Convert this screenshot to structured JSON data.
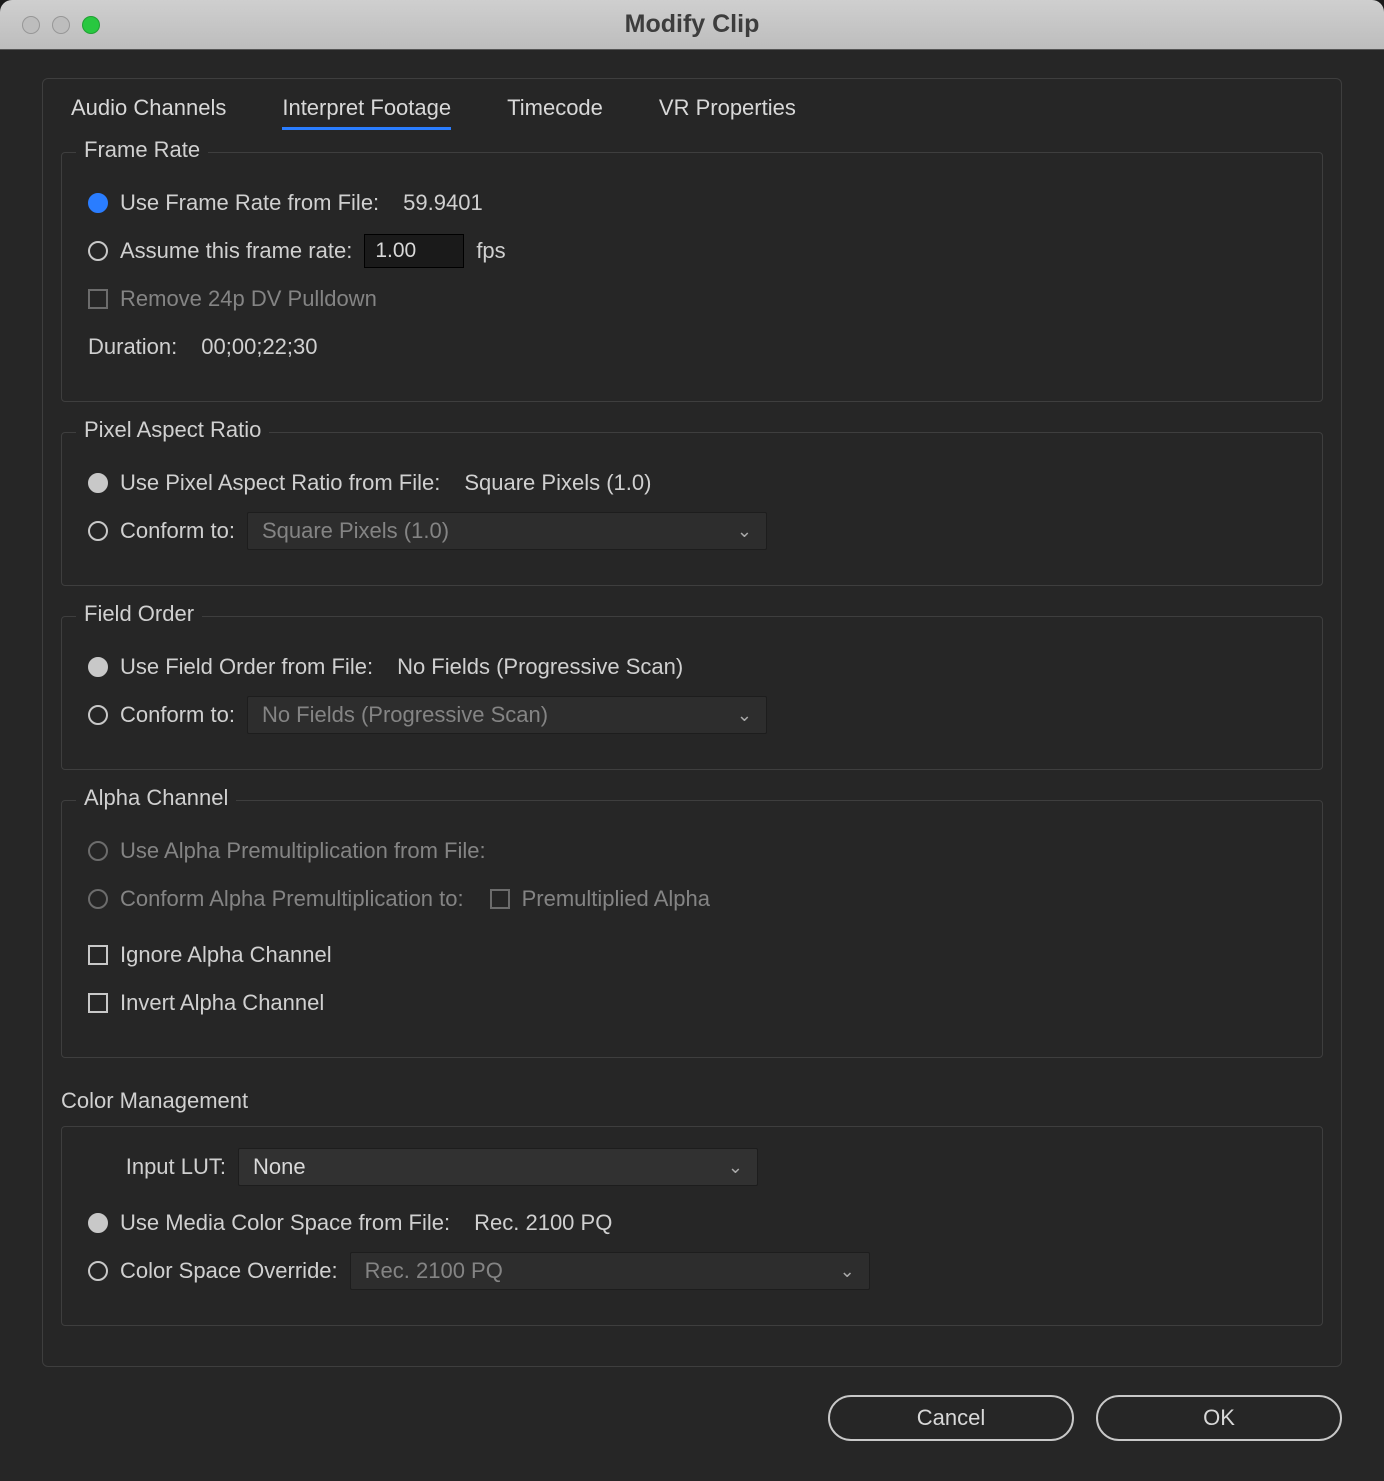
{
  "window": {
    "title": "Modify Clip"
  },
  "tabs": [
    {
      "label": "Audio Channels"
    },
    {
      "label": "Interpret Footage"
    },
    {
      "label": "Timecode"
    },
    {
      "label": "VR Properties"
    }
  ],
  "frameRate": {
    "legend": "Frame Rate",
    "useFromFileLabel": "Use Frame Rate from File:",
    "useFromFileValue": "59.9401",
    "assumeLabel": "Assume this frame rate:",
    "assumeValue": "1.00",
    "fpsSuffix": "fps",
    "removePulldownLabel": "Remove 24p DV Pulldown",
    "durationLabel": "Duration:",
    "durationValue": "00;00;22;30"
  },
  "pixelAspect": {
    "legend": "Pixel Aspect Ratio",
    "useFromFileLabel": "Use Pixel Aspect Ratio from File:",
    "useFromFileValue": "Square Pixels (1.0)",
    "conformLabel": "Conform to:",
    "conformValue": "Square Pixels (1.0)"
  },
  "fieldOrder": {
    "legend": "Field Order",
    "useFromFileLabel": "Use Field Order from File:",
    "useFromFileValue": "No Fields (Progressive Scan)",
    "conformLabel": "Conform to:",
    "conformValue": "No Fields (Progressive Scan)"
  },
  "alpha": {
    "legend": "Alpha Channel",
    "useFromFileLabel": "Use Alpha Premultiplication from File:",
    "conformLabel": "Conform Alpha Premultiplication to:",
    "premultLabel": "Premultiplied Alpha",
    "ignoreLabel": "Ignore Alpha Channel",
    "invertLabel": "Invert Alpha Channel"
  },
  "color": {
    "legend": "Color Management",
    "inputLutLabel": "Input LUT:",
    "inputLutValue": "None",
    "useMediaLabel": "Use Media Color Space from File:",
    "useMediaValue": "Rec. 2100 PQ",
    "overrideLabel": "Color Space Override:",
    "overrideValue": "Rec. 2100 PQ"
  },
  "footer": {
    "cancel": "Cancel",
    "ok": "OK"
  }
}
